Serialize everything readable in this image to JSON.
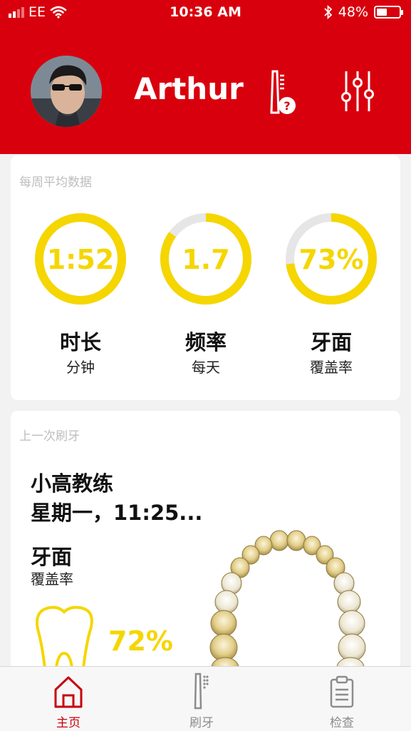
{
  "status_bar": {
    "carrier": "EE",
    "time": "10:36 AM",
    "battery": "48%",
    "battery_level": 0.48
  },
  "header": {
    "username": "Arthur",
    "icons": [
      "toothbrush-help-icon",
      "settings-sliders-icon"
    ],
    "background_color": "#d9000d"
  },
  "weekly": {
    "title": "每周平均数据",
    "stats": [
      {
        "value": "1:52",
        "label": "时长",
        "sub": "分钟",
        "progress": 1.0
      },
      {
        "value": "1.7",
        "label": "频率",
        "sub": "每天",
        "progress": 0.85
      },
      {
        "value": "73%",
        "label": "牙面",
        "sub": "覆盖率",
        "progress": 0.73
      }
    ],
    "accent_color": "#f5d600",
    "track_color": "#e6e6e6"
  },
  "last": {
    "title": "上一次刷牙",
    "coach": "小高教练",
    "day": "星期一，11:25...",
    "coverage_label": "牙面",
    "coverage_sub": "覆盖率",
    "coverage_value": "72%"
  },
  "tabs": [
    {
      "label": "主页",
      "icon": "home-icon",
      "active": true
    },
    {
      "label": "刷牙",
      "icon": "toothbrush-icon",
      "active": false
    },
    {
      "label": "检查",
      "icon": "clipboard-icon",
      "active": false
    }
  ],
  "active_tab_color": "#c8000c"
}
